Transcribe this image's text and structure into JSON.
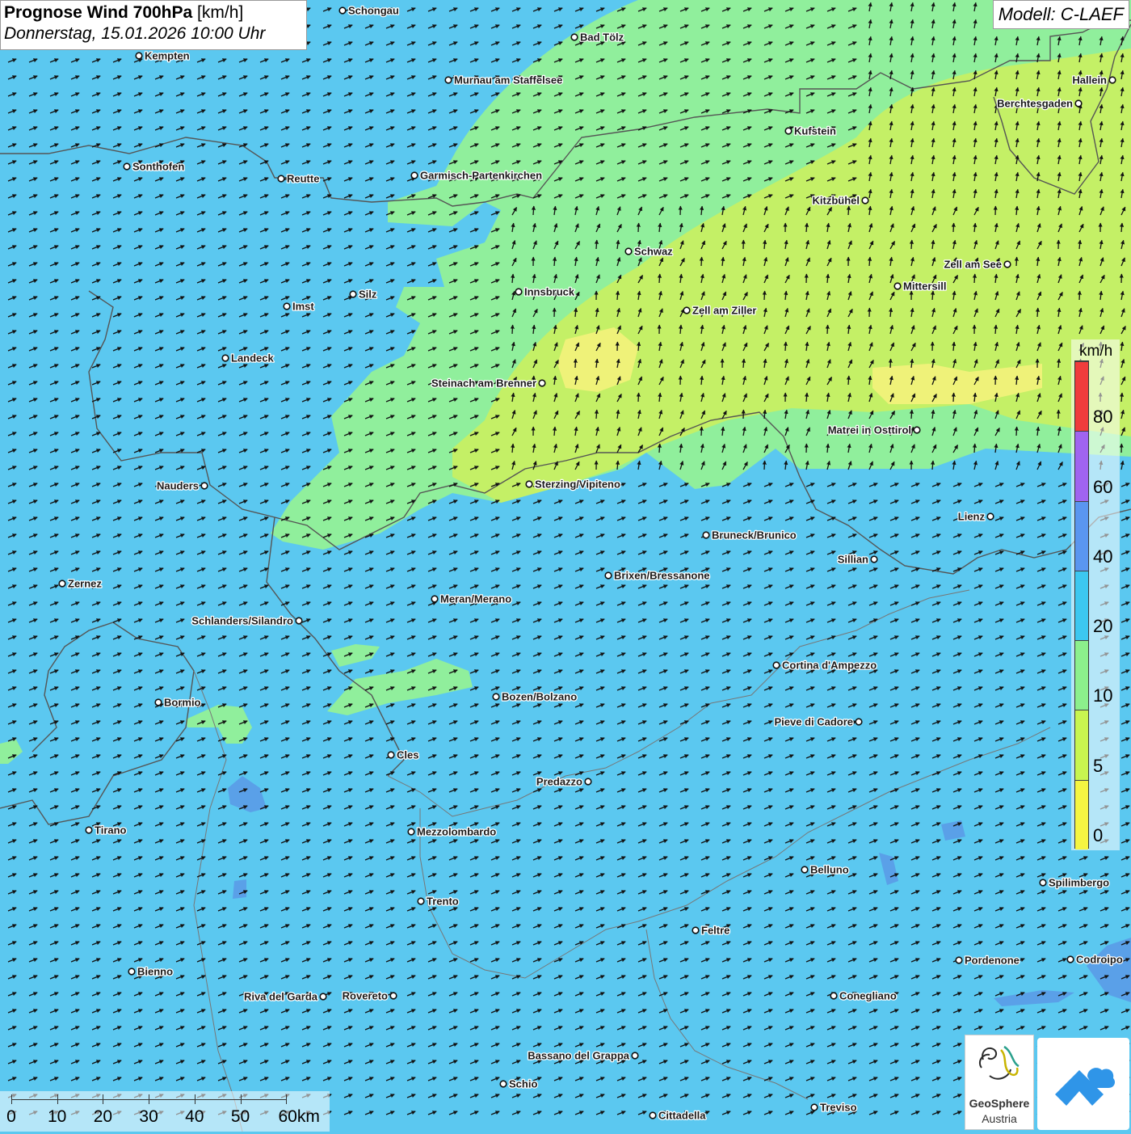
{
  "header": {
    "title": "Prognose Wind 700hPa",
    "unit": "[km/h]",
    "datetime": "Donnerstag, 15.01.2026 10:00 Uhr"
  },
  "model": "Modell: C-LAEF",
  "legend": {
    "unit": "km/h",
    "colors": [
      "#f5f542",
      "#c8f550",
      "#8cf08c",
      "#3cc8f0",
      "#5a96f0",
      "#a064f0",
      "#f03c3c"
    ],
    "labels": [
      "0",
      "5",
      "10",
      "20",
      "40",
      "60",
      "80"
    ]
  },
  "scale": {
    "labels": [
      "0",
      "10",
      "20",
      "30",
      "40",
      "50",
      "60km"
    ]
  },
  "logos": {
    "geosphere_name": "GeoSphere",
    "geosphere_sub": "Austria"
  },
  "cities": [
    {
      "name": "Schongau"
    },
    {
      "name": "Bad Tölz"
    },
    {
      "name": "Kempten"
    },
    {
      "name": "Murnau am Staffelsee"
    },
    {
      "name": "Hallein"
    },
    {
      "name": "Berchtesgaden"
    },
    {
      "name": "Kufstein"
    },
    {
      "name": "Sonthofen"
    },
    {
      "name": "Reutte"
    },
    {
      "name": "Garmisch-Partenkirchen"
    },
    {
      "name": "Kitzbühel"
    },
    {
      "name": "Schwaz"
    },
    {
      "name": "Zell am See"
    },
    {
      "name": "Mittersill"
    },
    {
      "name": "Innsbruck"
    },
    {
      "name": "Silz"
    },
    {
      "name": "Imst"
    },
    {
      "name": "Zell am Ziller"
    },
    {
      "name": "Landeck"
    },
    {
      "name": "Steinach am Brenner"
    },
    {
      "name": "Matrei in Osttirol"
    },
    {
      "name": "Nauders"
    },
    {
      "name": "Sterzing/Vipiteno"
    },
    {
      "name": "Lienz"
    },
    {
      "name": "Bruneck/Brunico"
    },
    {
      "name": "Sillian"
    },
    {
      "name": "Zernez"
    },
    {
      "name": "Brixen/Bressanone"
    },
    {
      "name": "Meran/Merano"
    },
    {
      "name": "Schlanders/Silandro"
    },
    {
      "name": "Cortina d'Ampezzo"
    },
    {
      "name": "Bozen/Bolzano"
    },
    {
      "name": "Bormio"
    },
    {
      "name": "Pieve di Cadore"
    },
    {
      "name": "Cles"
    },
    {
      "name": "Predazzo"
    },
    {
      "name": "Tirano"
    },
    {
      "name": "Mezzolombardo"
    },
    {
      "name": "Belluno"
    },
    {
      "name": "Spilimbergo"
    },
    {
      "name": "Trento"
    },
    {
      "name": "Feltre"
    },
    {
      "name": "Bienno"
    },
    {
      "name": "Pordenone"
    },
    {
      "name": "Codroipo"
    },
    {
      "name": "Riva del Garda"
    },
    {
      "name": "Rovereto"
    },
    {
      "name": "Conegliano"
    },
    {
      "name": "Bassano del Grappa"
    },
    {
      "name": "Schio"
    },
    {
      "name": "Treviso"
    },
    {
      "name": "Cittadella"
    }
  ]
}
